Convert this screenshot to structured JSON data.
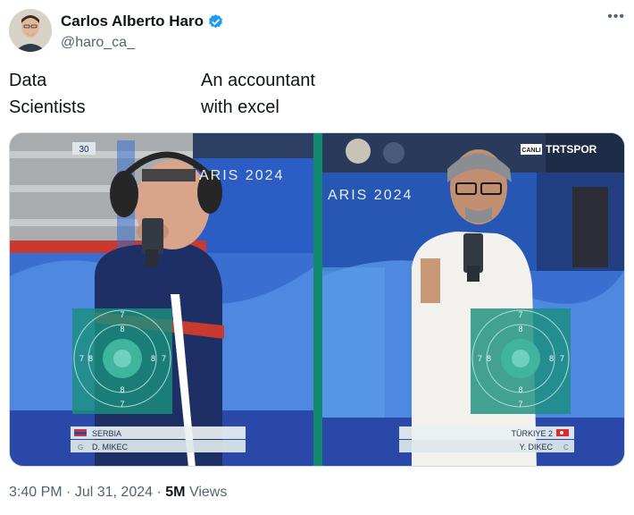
{
  "tweet": {
    "author": {
      "display_name": "Carlos Alberto Haro",
      "handle": "@haro_ca_",
      "verified_icon": "verified-badge-icon",
      "more_icon": "more-options-icon"
    },
    "text": {
      "left_line1": "Data",
      "left_line2": "Scientists",
      "right_line1": "An accountant",
      "right_line2": "with excel"
    },
    "media": {
      "left": {
        "shot_count": "30",
        "backdrop_text": "ARIS 2024",
        "country": "SERBIA",
        "athlete": "D. MIKEC",
        "position_tag": "G",
        "target_rings": [
          "7",
          "8",
          "8",
          "7",
          "7",
          "8",
          "8",
          "7"
        ]
      },
      "right": {
        "backdrop_text": "ARIS 2024",
        "broadcaster_live": "CANLI",
        "broadcaster": "TRTSPOR",
        "country": "TÜRKIYE 2",
        "athlete": "Y. DIKEC",
        "position_tag": "C",
        "target_rings": [
          "7",
          "8",
          "8",
          "7",
          "7",
          "8",
          "8",
          "7"
        ]
      },
      "colors": {
        "divider": "#138a6f",
        "target_teal": "#1b8f7d",
        "arena_blue": "#3a6fd1"
      }
    },
    "meta": {
      "time": "3:40 PM",
      "date": "Jul 31, 2024",
      "views_count": "5M",
      "views_label": "Views"
    }
  }
}
